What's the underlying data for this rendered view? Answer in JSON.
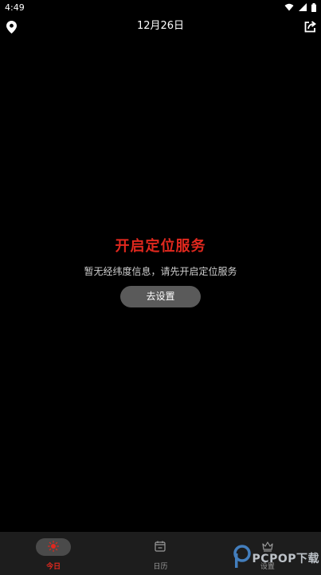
{
  "status_bar": {
    "time": "4:49"
  },
  "header": {
    "date": "12月26日",
    "location_icon": "location-pin-icon",
    "share_icon": "share-icon"
  },
  "main": {
    "headline": "开启定位服务",
    "description": "暂无经纬度信息，请先开启定位服务",
    "button_label": "去设置"
  },
  "bottom_nav": {
    "items": [
      {
        "label": "今日",
        "icon": "sun-icon",
        "active": true
      },
      {
        "label": "日历",
        "icon": "calendar-icon",
        "active": false
      },
      {
        "label": "设置",
        "icon": "crown-icon",
        "active": false
      }
    ]
  },
  "watermark": {
    "text": "PCPOP下载"
  },
  "colors": {
    "background": "#000000",
    "accent": "#e0281e",
    "button_bg": "#5a5a5a",
    "nav_bg": "#1d1d1d"
  }
}
